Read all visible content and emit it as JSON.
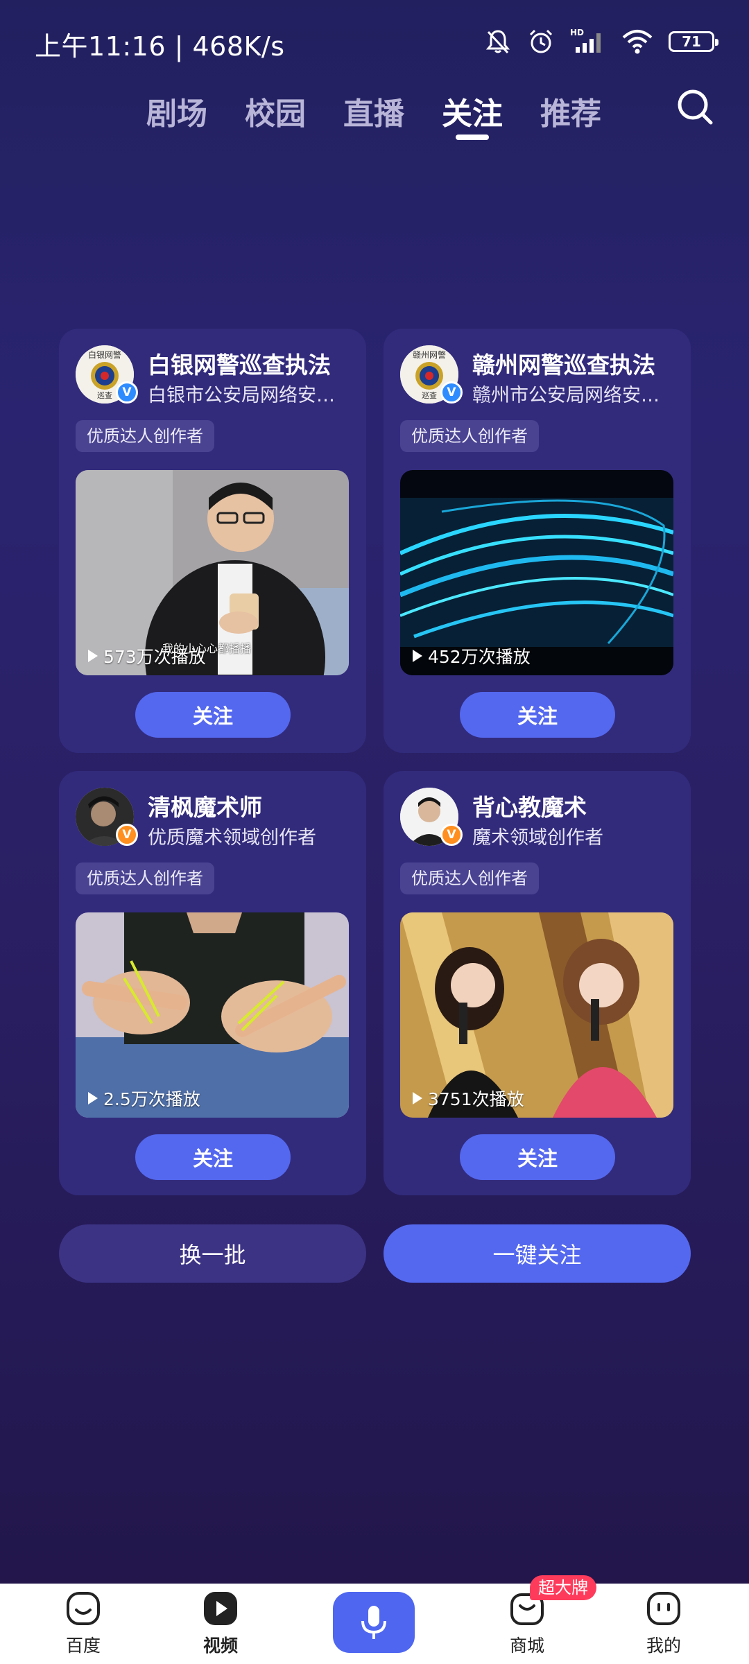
{
  "status_bar": {
    "time_speed": "上午11:16 | 468K/s",
    "network_label": "HD",
    "battery": "71"
  },
  "tabs": [
    {
      "label": "剧场"
    },
    {
      "label": "校园"
    },
    {
      "label": "直播"
    },
    {
      "label": "关注",
      "active": true
    },
    {
      "label": "推荐"
    }
  ],
  "cards": [
    {
      "name": "白银网警巡查执法",
      "desc": "白银市公安局网络安全保卫支队",
      "tag": "优质达人创作者",
      "avatar_icon": "police-emblem",
      "avatar_text": "白银网警",
      "badge": "V",
      "views": "573万次播放",
      "caption": "我的小心心都播播",
      "follow_label": "关注"
    },
    {
      "name": "赣州网警巡查执法",
      "desc": "赣州市公安局网络安全保卫支队",
      "tag": "优质达人创作者",
      "avatar_icon": "police-emblem",
      "avatar_text": "赣州网警",
      "badge": "V",
      "views": "452万次播放",
      "follow_label": "关注"
    },
    {
      "name": "清枫魔术师",
      "desc": "优质魔术领域创作者",
      "tag": "优质达人创作者",
      "avatar_icon": "person-photo",
      "badge": "V",
      "views": "2.5万次播放",
      "follow_label": "关注"
    },
    {
      "name": "背心教魔术",
      "desc": "魔术领域创作者",
      "tag": "优质达人创作者",
      "avatar_icon": "person-photo",
      "badge": "V",
      "views": "3751次播放",
      "follow_label": "关注"
    }
  ],
  "actions": {
    "refresh": "换一批",
    "follow_all": "一键关注"
  },
  "bottom_nav": [
    {
      "label": "百度"
    },
    {
      "label": "视频"
    },
    {
      "label": "商城",
      "badge": "超大牌"
    },
    {
      "label": "我的"
    }
  ],
  "colors": {
    "accent": "#5468ef",
    "card_bg": "#322b7c",
    "badge_blue": "#2f8cff",
    "badge_orange": "#ff8f1f",
    "promo_red": "#ff3b5c"
  }
}
